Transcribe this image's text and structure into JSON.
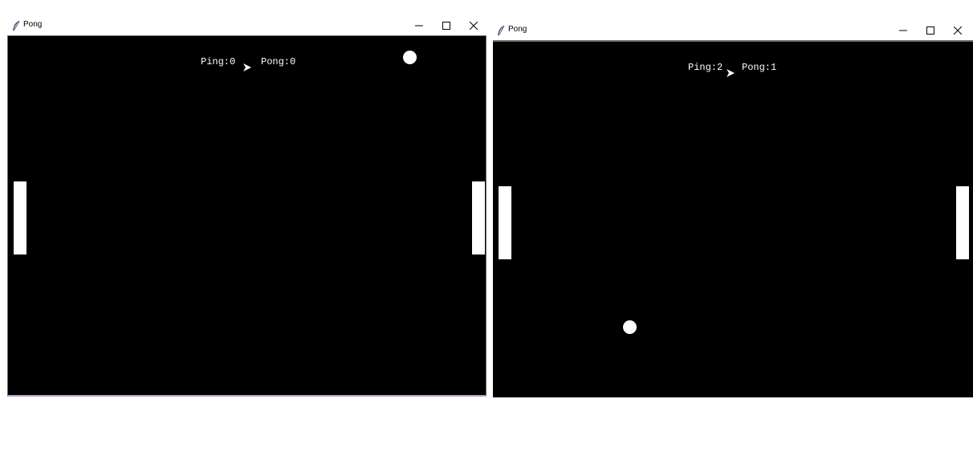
{
  "colors": {
    "canvas_background": "#000000",
    "paddle": "#ffffff",
    "ball": "#ffffff",
    "score_text": "#ffffff",
    "window_accent_border": "#c79ad8"
  },
  "windows": [
    {
      "title": "Pong",
      "app_icon": "feather-icon",
      "controls": [
        "minimize",
        "maximize",
        "close"
      ],
      "score": {
        "left": "Ping:0",
        "right": "Pong:0"
      }
    },
    {
      "title": "Pong",
      "app_icon": "feather-icon",
      "controls": [
        "minimize",
        "maximize",
        "close"
      ],
      "score": {
        "left": "Ping:2",
        "right": "Pong:1"
      }
    }
  ]
}
